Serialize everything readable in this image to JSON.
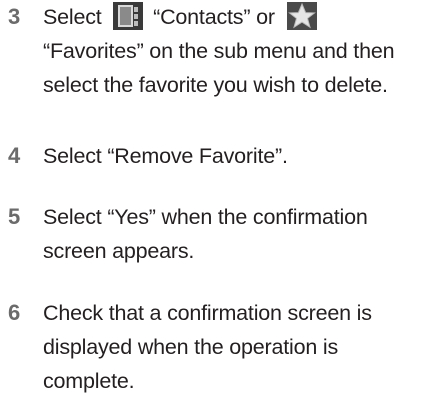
{
  "steps": [
    {
      "number": "3",
      "parts": {
        "lead": "Select",
        "contacts": "“Contacts” or",
        "rest": "“Favorites” on the sub menu and then select the favorite you wish to delete."
      },
      "icons": [
        "contacts-icon",
        "favorites-star-icon"
      ]
    },
    {
      "number": "4",
      "text": "Select “Remove Favorite”."
    },
    {
      "number": "5",
      "text": "Select “Yes” when the confirmation screen appears."
    },
    {
      "number": "6",
      "text": "Check that a confirmation screen is displayed when the operation is complete."
    }
  ],
  "colors": {
    "number_gray": "#6b6b6b",
    "text": "#231f20",
    "icon_dark": "#3a3a3a",
    "icon_light": "#bdbdbd"
  }
}
